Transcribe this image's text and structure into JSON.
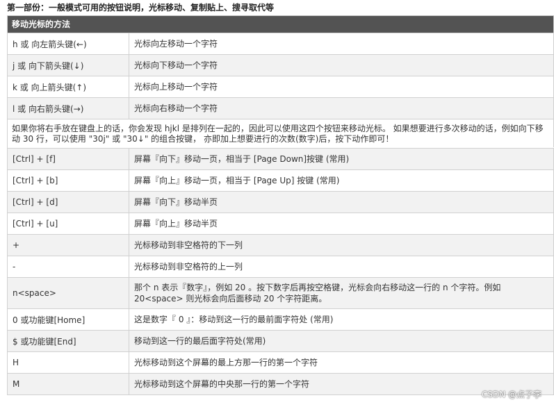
{
  "heading": "第一部份：一般模式可用的按钮说明，光标移动、复制贴上、搜寻取代等",
  "table": {
    "header": "移动光标的方法",
    "rows_a": [
      {
        "key": "h 或 向左箭头键(←)",
        "desc": "光标向左移动一个字符"
      },
      {
        "key": "j 或 向下箭头键(↓)",
        "desc": "光标向下移动一个字符"
      },
      {
        "key": "k 或 向上箭头键(↑)",
        "desc": "光标向上移动一个字符"
      },
      {
        "key": "l 或 向右箭头键(→)",
        "desc": "光标向右移动一个字符"
      }
    ],
    "note": "如果你将右手放在键盘上的话，你会发现 hjkl 是排列在一起的，因此可以使用这四个按钮来移动光标。 如果想要进行多次移动的话，例如向下移动 30 行，可以使用 \"30j\" 或 \"30↓\" 的组合按键， 亦即加上想要进行的次数(数字)后，按下动作即可！",
    "rows_b": [
      {
        "key": "[Ctrl] + [f]",
        "desc": "屏幕『向下』移动一页，相当于 [Page Down]按键 (常用)"
      },
      {
        "key": "[Ctrl] + [b]",
        "desc": "屏幕『向上』移动一页，相当于 [Page Up] 按键 (常用)"
      },
      {
        "key": "[Ctrl] + [d]",
        "desc": "屏幕『向下』移动半页"
      },
      {
        "key": "[Ctrl] + [u]",
        "desc": "屏幕『向上』移动半页"
      },
      {
        "key": "+",
        "desc": "光标移动到非空格符的下一列"
      },
      {
        "key": "-",
        "desc": "光标移动到非空格符的上一列"
      },
      {
        "key": "n<space>",
        "desc": "那个 n 表示『数字』，例如 20 。按下数字后再按空格键，光标会向右移动这一行的 n 个字符。例如 20<space> 则光标会向后面移动 20 个字符距离。"
      },
      {
        "key": "0 或功能键[Home]",
        "desc": "这是数字『 0 』：移动到这一行的最前面字符处 (常用)"
      },
      {
        "key": "$ 或功能键[End]",
        "desc": "移动到这一行的最后面字符处(常用)"
      },
      {
        "key": "H",
        "desc": "光标移动到这个屏幕的最上方那一行的第一个字符"
      },
      {
        "key": "M",
        "desc": "光标移动到这个屏幕的中央那一行的第一个字符"
      }
    ]
  },
  "watermark": "CSDN @点子李"
}
